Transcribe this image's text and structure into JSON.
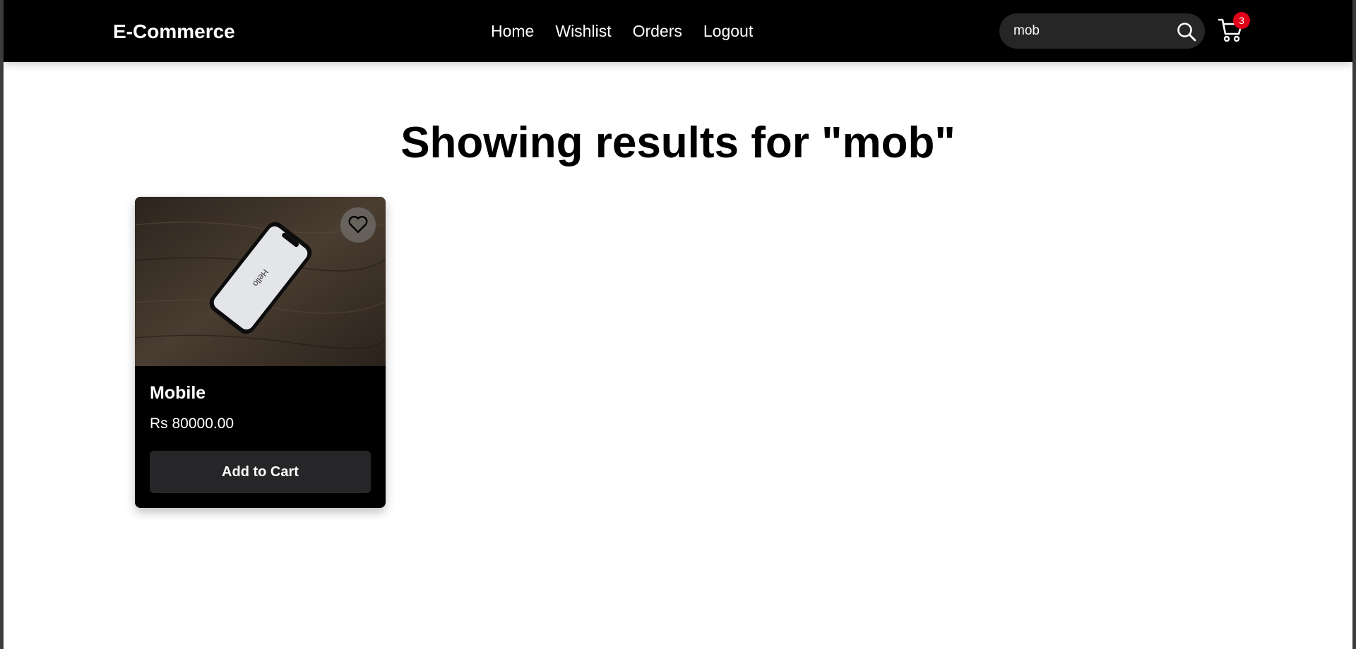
{
  "navbar": {
    "brand": "E-Commerce",
    "links": [
      {
        "label": "Home"
      },
      {
        "label": "Wishlist"
      },
      {
        "label": "Orders"
      },
      {
        "label": "Logout"
      }
    ],
    "search": {
      "value": "mob",
      "icon": "search-icon"
    },
    "cart": {
      "icon": "cart-icon",
      "count": "3"
    }
  },
  "main": {
    "heading": "Showing results for \"mob\"",
    "products": [
      {
        "name": "Mobile",
        "price": "Rs 80000.00",
        "button_label": "Add to Cart",
        "wishlist_icon": "heart-icon",
        "image_text": "Hello"
      }
    ]
  },
  "colors": {
    "navbar": "#000000",
    "badge": "#e00018",
    "card": "#000000",
    "button": "#262628"
  }
}
